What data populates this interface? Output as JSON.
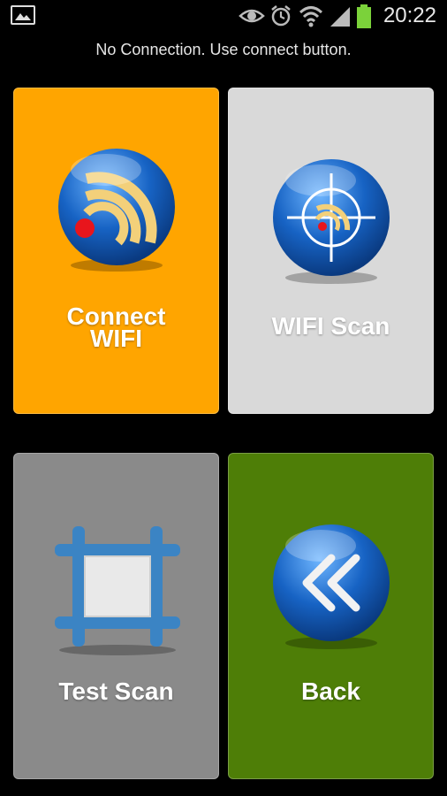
{
  "status_bar": {
    "time": "20:22",
    "icons": [
      "gallery-icon",
      "eye-icon",
      "alarm-icon",
      "wifi-icon",
      "signal-icon",
      "battery-icon"
    ]
  },
  "message": "No Connection. Use connect button.",
  "tiles": [
    {
      "id": "connect",
      "label_line1": "Connect",
      "label_line2": "WIFI",
      "color": "#ffa500",
      "icon": "rss-wifi-globe-icon"
    },
    {
      "id": "wifi_scan",
      "label": "WIFI Scan",
      "color": "#d9d9d9",
      "icon": "crosshair-globe-icon"
    },
    {
      "id": "test_scan",
      "label": "Test Scan",
      "color": "#8a8a8a",
      "icon": "frame-square-icon"
    },
    {
      "id": "back",
      "label": "Back",
      "color": "#4e7e07",
      "icon": "double-chevron-left-icon"
    }
  ]
}
